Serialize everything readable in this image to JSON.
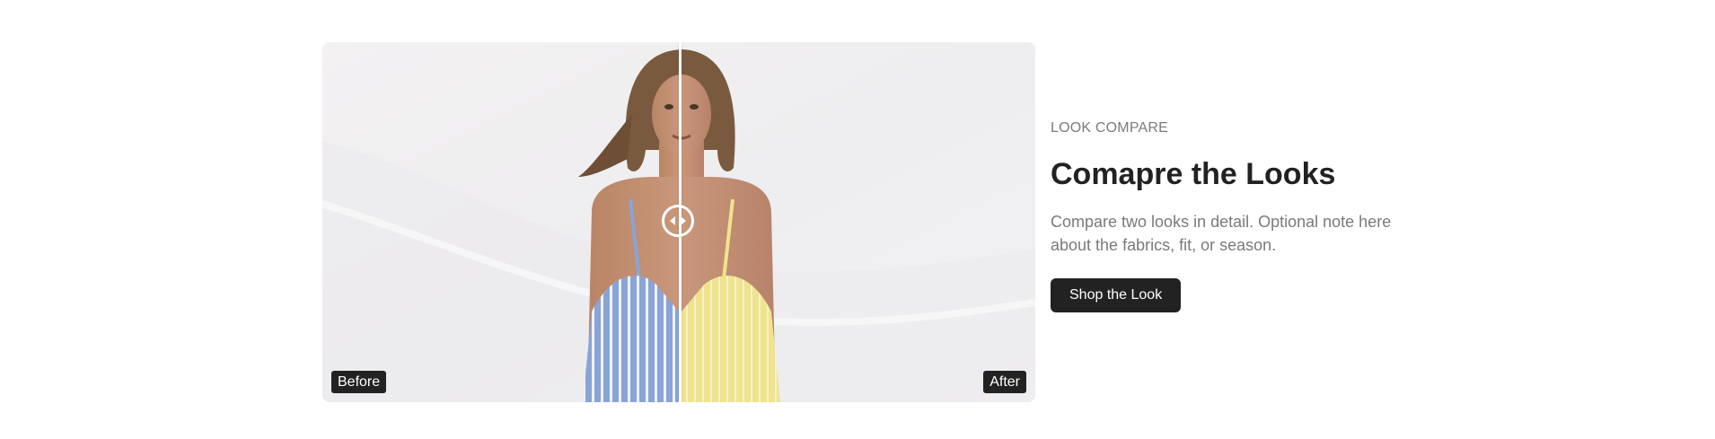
{
  "compare": {
    "before_label": "Before",
    "after_label": "After",
    "divider_position": 0.5,
    "handle_icon": "left-right-arrows-icon",
    "before_dress_color": "#8aa4d6",
    "after_dress_color": "#efe38f",
    "background_color": "#f1eff0"
  },
  "content": {
    "eyebrow": "LOOK COMPARE",
    "heading": "Comapre the Looks",
    "description": "Compare two looks in detail. Optional note here about the fabrics, fit, or season.",
    "cta_label": "Shop the Look"
  }
}
